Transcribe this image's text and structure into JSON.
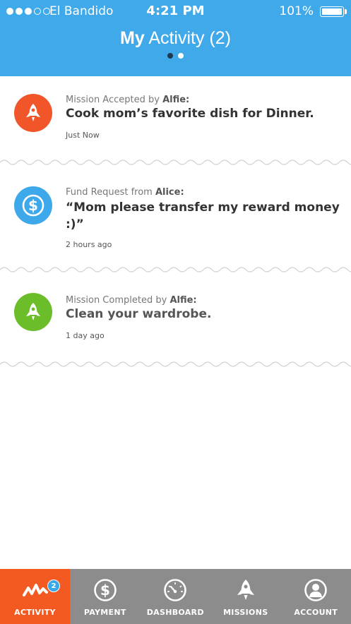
{
  "status_bar": {
    "carrier": "El Bandido",
    "time": "4:21 PM",
    "battery": "101%"
  },
  "header": {
    "title_bold": "My",
    "title_rest": "Activity (2)",
    "pages": 2,
    "active_page": 1,
    "color": "#40a9ea"
  },
  "feed": [
    {
      "icon": "rocket-icon",
      "icon_color": "#f0562a",
      "subtitle_prefix": "Mission Accepted by ",
      "subtitle_name": "Alfie:",
      "message": "Cook mom’s favorite dish for Dinner.",
      "time": "Just Now"
    },
    {
      "icon": "dollar-icon",
      "icon_color": "#3ea9ea",
      "subtitle_prefix": "Fund Request from ",
      "subtitle_name": "Alice:",
      "message": "“Mom please transfer my reward money :)”",
      "time": "2 hours ago"
    },
    {
      "icon": "rocket-icon",
      "icon_color": "#6bbd2a",
      "subtitle_prefix": "Mission Completed by ",
      "subtitle_name": "Alfie:",
      "message": "Clean your wardrobe.",
      "time": "1 day ago"
    }
  ],
  "tabbar": {
    "active_color": "#f25a22",
    "background": "#8c8c8c",
    "tabs": [
      {
        "label": "ACTIVITY",
        "icon": "activity-wave-icon",
        "badge": "2"
      },
      {
        "label": "PAYMENT",
        "icon": "dollar-icon"
      },
      {
        "label": "DASHBOARD",
        "icon": "gauge-icon"
      },
      {
        "label": "MISSIONS",
        "icon": "rocket-icon"
      },
      {
        "label": "ACCOUNT",
        "icon": "user-icon"
      }
    ]
  }
}
